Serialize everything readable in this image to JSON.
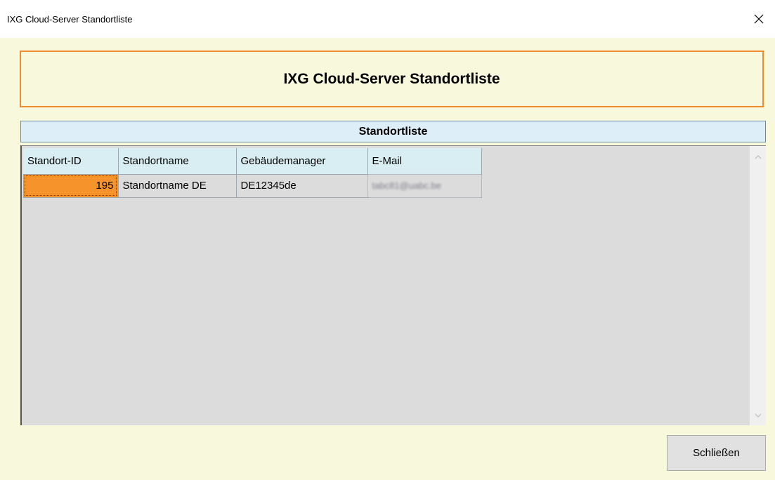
{
  "window": {
    "title": "IXG Cloud-Server Standortliste",
    "close_icon": "close-icon"
  },
  "header": {
    "heading": "IXG Cloud-Server Standortliste"
  },
  "section": {
    "title": "Standortliste"
  },
  "table": {
    "columns": [
      "Standort-ID",
      "Standortname",
      "Gebäudemanager",
      "E-Mail"
    ],
    "rows": [
      {
        "id": "195",
        "name": "Standortname DE",
        "manager": "DE12345de",
        "email": "tabc81@uabc.be"
      }
    ]
  },
  "footer": {
    "close_label": "Schließen"
  },
  "colors": {
    "background": "#f8f8dc",
    "accent_border": "#f08a2c",
    "selected_cell": "#f6932a",
    "header_cell": "#d8eef2",
    "section_bar": "#ddeef9"
  }
}
